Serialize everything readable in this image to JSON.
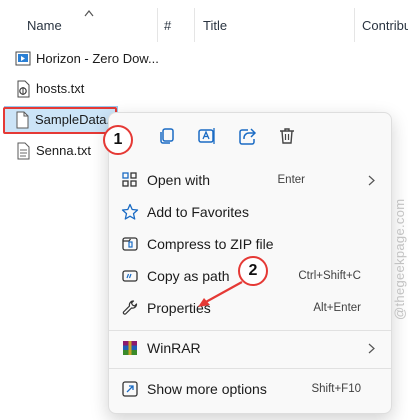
{
  "columns": [
    "Name",
    "#",
    "Title",
    "Contribu"
  ],
  "files": [
    {
      "name": "Horizon - Zero Dow...",
      "icon": "media-file-icon"
    },
    {
      "name": "hosts.txt",
      "icon": "open-with-file-icon"
    },
    {
      "name": "SampleData.c",
      "icon": "document-file-icon",
      "selected": true
    },
    {
      "name": "Senna.txt",
      "icon": "text-file-icon"
    }
  ],
  "quick_actions": [
    "copy-icon",
    "rename-icon",
    "share-icon",
    "delete-icon"
  ],
  "menu": {
    "open_with": {
      "label": "Open with",
      "shortcut": "Enter"
    },
    "favorites": {
      "label": "Add to Favorites"
    },
    "compress": {
      "label": "Compress to ZIP file"
    },
    "copy_path": {
      "label": "Copy as path",
      "shortcut": "Ctrl+Shift+C"
    },
    "properties": {
      "label": "Properties",
      "shortcut": "Alt+Enter"
    },
    "winrar": {
      "label": "WinRAR"
    },
    "more_options": {
      "label": "Show more options",
      "shortcut": "Shift+F10"
    }
  },
  "badges": {
    "step1": "1",
    "step2": "2"
  },
  "watermark": "@thegeekpage.com",
  "colors": {
    "accent": "#e53935",
    "selection": "#cce4f7",
    "icon_blue": "#1a6bc4"
  }
}
